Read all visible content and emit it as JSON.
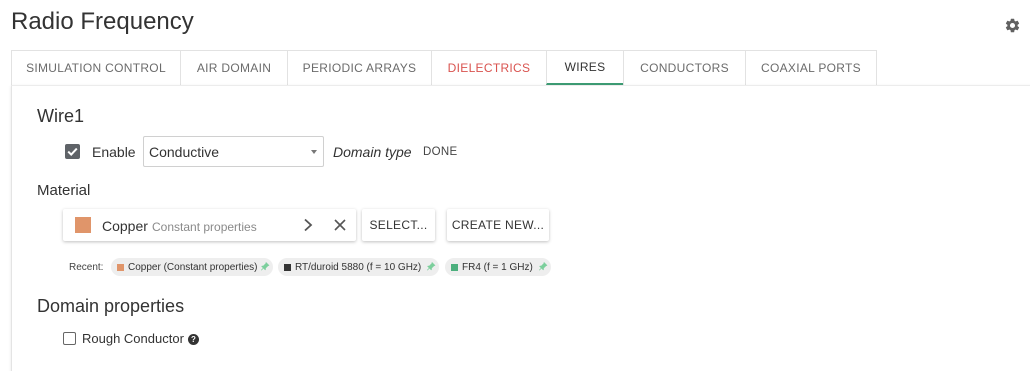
{
  "app": {
    "title": "Radio Frequency",
    "settings_icon": "gear-icon"
  },
  "tabs": [
    {
      "label": "SIMULATION CONTROL",
      "state": "normal"
    },
    {
      "label": "AIR DOMAIN",
      "state": "normal"
    },
    {
      "label": "PERIODIC ARRAYS",
      "state": "normal"
    },
    {
      "label": "DIELECTRICS",
      "state": "error",
      "color": "#d9534f"
    },
    {
      "label": "WIRES",
      "state": "active",
      "accent": "#3d9c74"
    },
    {
      "label": "CONDUCTORS",
      "state": "normal"
    },
    {
      "label": "COAXIAL PORTS",
      "state": "normal"
    }
  ],
  "wire": {
    "heading": "Wire1",
    "enable_label": "Enable",
    "enable_checked": true,
    "domain_select_value": "Conductive",
    "domain_type_label": "Domain type",
    "domain_type_value": "DONE"
  },
  "material": {
    "heading": "Material",
    "name": "Copper",
    "subtitle": "Constant properties",
    "swatch_color": "#e0956a",
    "select_button": "SELECT...",
    "create_button": "CREATE NEW...",
    "recent_label": "Recent:",
    "recent": [
      {
        "label": "Copper (Constant properties)",
        "color": "#e0956a"
      },
      {
        "label": "RT/duroid 5880 (f = 10 GHz)",
        "color": "#333333"
      },
      {
        "label": "FR4 (f = 1 GHz)",
        "color": "#4caf7d"
      }
    ],
    "pin_color": "#7ccf9c"
  },
  "domain_properties": {
    "heading": "Domain properties",
    "rough_label": "Rough Conductor",
    "rough_checked": false,
    "help_symbol": "?"
  }
}
